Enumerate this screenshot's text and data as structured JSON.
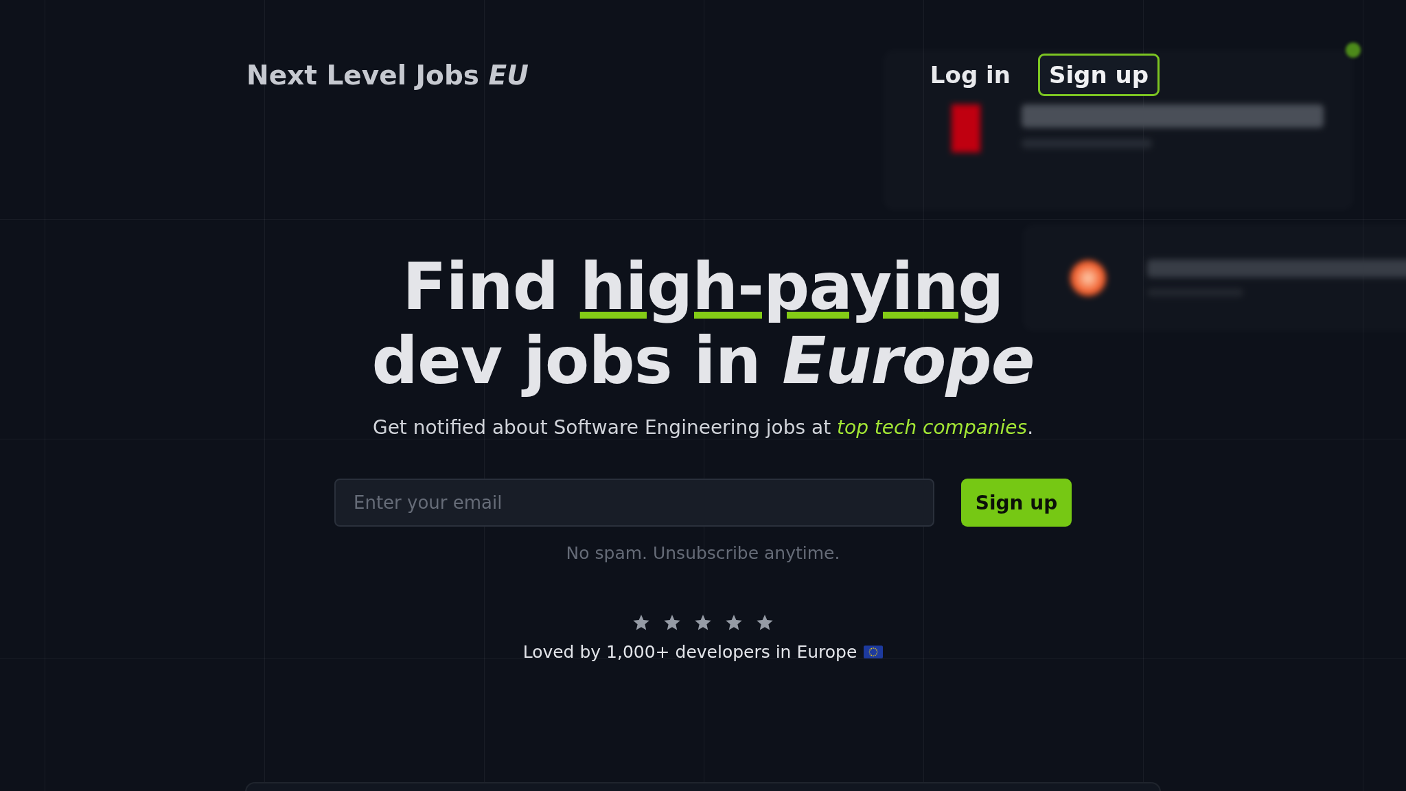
{
  "header": {
    "logo": "Next Level Jobs *EU*",
    "login": "Log in",
    "signup": "Sign up"
  },
  "hero": {
    "title_before": "Find ",
    "title_highlight": "high-paying",
    "title_after": "dev jobs in *Europe*",
    "subtitle": "Get notified about Software Engineering jobs at *top tech companies*."
  },
  "form": {
    "placeholder": "Enter your email",
    "button": "Sign up",
    "note": "No spam. Unsubscribe anytime."
  },
  "rating": {
    "stars": 5,
    "text": "Loved by 1,000+ developers in Europe"
  }
}
